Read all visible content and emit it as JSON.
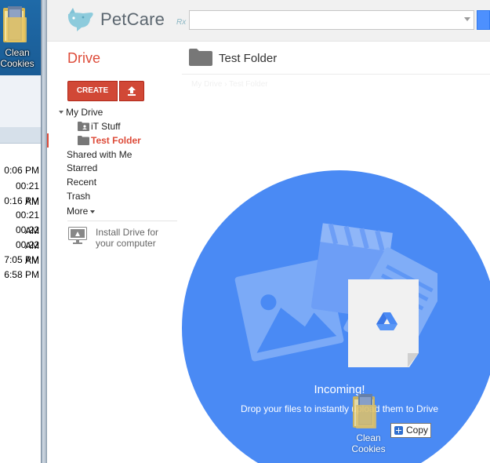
{
  "desktop": {
    "folder_label_line1": "Clean",
    "folder_label_line2": "Cookies"
  },
  "background_window": {
    "times": [
      "0:06 PM",
      "00:21 AM",
      "0:16 PM",
      "00:21 AM",
      "00:22 AM",
      "00:22 AM",
      "7:05 PM",
      "6:58 PM"
    ]
  },
  "header": {
    "logo_text": "PetCare",
    "logo_sub": "Rx",
    "search_value": ""
  },
  "drive": {
    "title": "Drive",
    "folder_title": "Test Folder",
    "breadcrumb": [
      "My Drive",
      "Test Folder"
    ]
  },
  "nav": {
    "create_label": "CREATE",
    "my_drive": "My Drive",
    "folders": [
      "iT Stuff",
      "Test Folder"
    ],
    "items": [
      "Shared with Me",
      "Starred",
      "Recent",
      "Trash"
    ],
    "more": "More",
    "install_line1": "Install Drive for",
    "install_line2": "your computer"
  },
  "dropzone": {
    "title": "Incoming!",
    "text": "Drop your files to instantly upload them to Drive"
  },
  "drag": {
    "label_line1": "Clean",
    "label_line2": "Cookies",
    "tooltip": "Copy"
  },
  "colors": {
    "drive_red": "#dd4b39",
    "create_button": "#d14836",
    "dropzone_blue": "#4a8af4",
    "search_button": "#4d90fe"
  }
}
